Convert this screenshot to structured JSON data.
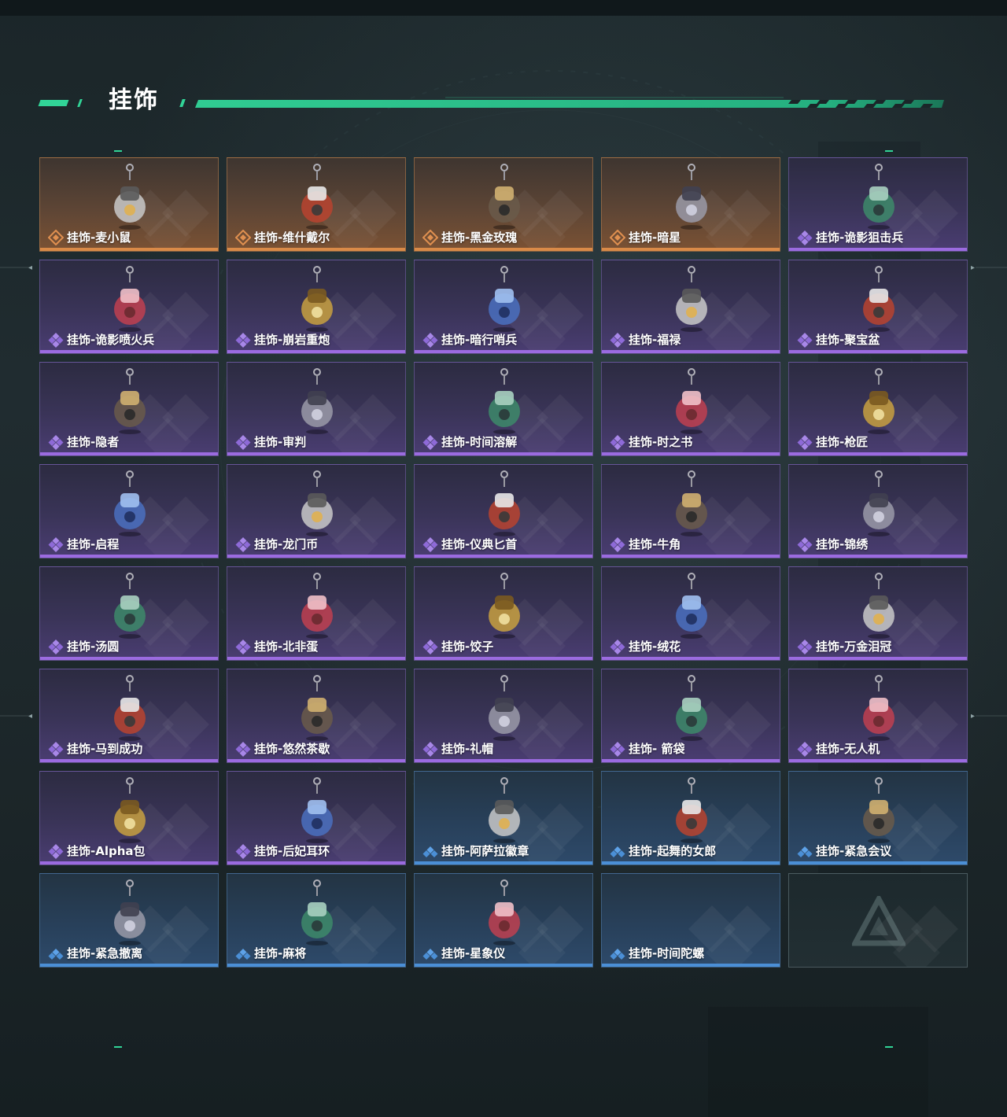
{
  "header": {
    "title": "挂饰"
  },
  "colors": {
    "accent_green": "#31d497",
    "gold": "#d98a48",
    "purple": "#9b6be0",
    "blue": "#4b8fd6"
  },
  "items": [
    {
      "label": "挂饰-麦小鼠",
      "rarity": "gold",
      "icon": "mouse-mascot-charm-icon"
    },
    {
      "label": "挂饰-维什戴尔",
      "rarity": "gold",
      "icon": "card-charm-icon"
    },
    {
      "label": "挂饰-黑金玫瑰",
      "rarity": "gold",
      "icon": "black-gold-rose-charm-icon"
    },
    {
      "label": "挂饰-暗星",
      "rarity": "gold",
      "icon": "dark-star-charm-icon"
    },
    {
      "label": "挂饰-诡影狙击兵",
      "rarity": "purple",
      "icon": "sniper-figure-charm-icon"
    },
    {
      "label": "挂饰-诡影喷火兵",
      "rarity": "purple",
      "icon": "flamethrower-figure-charm-icon"
    },
    {
      "label": "挂饰-崩岩重炮",
      "rarity": "purple",
      "icon": "heavy-gunner-figure-charm-icon"
    },
    {
      "label": "挂饰-暗行哨兵",
      "rarity": "purple",
      "icon": "sentinel-figure-charm-icon"
    },
    {
      "label": "挂饰-福禄",
      "rarity": "purple",
      "icon": "gourd-charm-icon"
    },
    {
      "label": "挂饰-聚宝盆",
      "rarity": "purple",
      "icon": "treasure-bowl-charm-icon"
    },
    {
      "label": "挂饰-隐者",
      "rarity": "purple",
      "icon": "hermit-tarot-card-charm-icon"
    },
    {
      "label": "挂饰-审判",
      "rarity": "purple",
      "icon": "judgement-tarot-card-charm-icon"
    },
    {
      "label": "挂饰-时间溶解",
      "rarity": "purple",
      "icon": "melting-clock-charm-icon"
    },
    {
      "label": "挂饰-时之书",
      "rarity": "purple",
      "icon": "book-charm-icon"
    },
    {
      "label": "挂饰-枪匠",
      "rarity": "purple",
      "icon": "gunsmith-charm-icon"
    },
    {
      "label": "挂饰-启程",
      "rarity": "purple",
      "icon": "ring-logo-charm-icon"
    },
    {
      "label": "挂饰-龙门币",
      "rarity": "purple",
      "icon": "crystal-tag-charm-icon"
    },
    {
      "label": "挂饰-仪典匕首",
      "rarity": "purple",
      "icon": "dagger-charm-icon"
    },
    {
      "label": "挂饰-牛角",
      "rarity": "purple",
      "icon": "horns-skull-charm-icon"
    },
    {
      "label": "挂饰-锦绣",
      "rarity": "purple",
      "icon": "butterfly-charm-icon"
    },
    {
      "label": "挂饰-汤圆",
      "rarity": "purple",
      "icon": "rice-dumpling-bowl-charm-icon"
    },
    {
      "label": "挂饰-北非蛋",
      "rarity": "purple",
      "icon": "shakshuka-pan-charm-icon"
    },
    {
      "label": "挂饰-饺子",
      "rarity": "purple",
      "icon": "dumpling-plate-charm-icon"
    },
    {
      "label": "挂饰-绒花",
      "rarity": "purple",
      "icon": "red-flower-charm-icon"
    },
    {
      "label": "挂饰-万金泪冠",
      "rarity": "purple",
      "icon": "golden-crown-charm-icon"
    },
    {
      "label": "挂饰-马到成功",
      "rarity": "purple",
      "icon": "red-horse-charm-icon"
    },
    {
      "label": "挂饰-悠然茶歇",
      "rarity": "purple",
      "icon": "cupcake-charm-icon"
    },
    {
      "label": "挂饰-礼帽",
      "rarity": "purple",
      "icon": "fedora-hat-charm-icon"
    },
    {
      "label": "挂饰- 箭袋",
      "rarity": "purple",
      "icon": "quiver-charm-icon"
    },
    {
      "label": "挂饰-无人机",
      "rarity": "purple",
      "icon": "drone-wheels-charm-icon"
    },
    {
      "label": "挂饰-Alpha包",
      "rarity": "purple",
      "icon": "alpha-pouch-charm-icon"
    },
    {
      "label": "挂饰-后妃耳环",
      "rarity": "purple",
      "icon": "earring-charm-icon"
    },
    {
      "label": "挂饰-阿萨拉徽章",
      "rarity": "blue",
      "icon": "emblem-badge-charm-icon"
    },
    {
      "label": "挂饰-起舞的女郎",
      "rarity": "blue",
      "icon": "dancer-figurine-charm-icon"
    },
    {
      "label": "挂饰-紧急会议",
      "rarity": "blue",
      "icon": "emergency-meeting-charm-icon"
    },
    {
      "label": "挂饰-紧急撤离",
      "rarity": "blue",
      "icon": "exit-sign-charm-icon"
    },
    {
      "label": "挂饰-麻将",
      "rarity": "blue",
      "icon": "mahjong-tile-charm-icon"
    },
    {
      "label": "挂饰-星象仪",
      "rarity": "blue",
      "icon": "astrolabe-charm-icon"
    },
    {
      "label": "挂饰-时间陀螺",
      "rarity": "blue",
      "icon": null
    },
    {
      "label": "",
      "rarity": "empty",
      "icon": "placeholder-logo-icon"
    }
  ]
}
